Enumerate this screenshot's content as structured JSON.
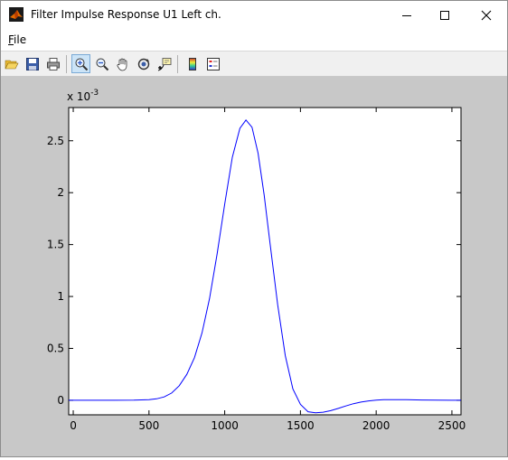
{
  "window": {
    "title": "Filter Impulse Response  U1 Left ch.",
    "controls": [
      "minimize",
      "maximize",
      "close"
    ]
  },
  "menu": {
    "file_label": "File"
  },
  "toolbar": {
    "buttons": [
      {
        "name": "open-file-button",
        "icon": "folder-open-icon"
      },
      {
        "name": "save-button",
        "icon": "floppy-disk-icon"
      },
      {
        "name": "print-button",
        "icon": "printer-icon"
      },
      {
        "name": "zoom-in-button",
        "icon": "zoom-in-icon",
        "active": true
      },
      {
        "name": "zoom-out-button",
        "icon": "zoom-out-icon"
      },
      {
        "name": "pan-button",
        "icon": "hand-icon"
      },
      {
        "name": "rotate-3d-button",
        "icon": "rotate-icon"
      },
      {
        "name": "data-cursor-button",
        "icon": "data-cursor-icon"
      },
      {
        "name": "insert-colorbar-button",
        "icon": "colorbar-icon"
      },
      {
        "name": "insert-legend-button",
        "icon": "legend-icon"
      }
    ]
  },
  "chart_data": {
    "type": "line",
    "title": "",
    "xlabel": "",
    "ylabel": "",
    "exponent_label": "x 10",
    "exponent_power": "-3",
    "xlim": [
      -30,
      2560
    ],
    "ylim": [
      -0.00014,
      0.00282
    ],
    "xticks": [
      0,
      500,
      1000,
      1500,
      2000,
      2500
    ],
    "yticks": [
      0,
      0.0005,
      0.001,
      0.0015,
      0.002,
      0.0025
    ],
    "ytick_labels": [
      "0",
      "0.5",
      "1",
      "1.5",
      "2",
      "2.5"
    ],
    "grid": false,
    "series": [
      {
        "color": "#0000ff",
        "x": [
          -30,
          0,
          200,
          400,
          500,
          550,
          600,
          650,
          700,
          750,
          800,
          850,
          900,
          950,
          1000,
          1050,
          1100,
          1140,
          1180,
          1220,
          1260,
          1300,
          1350,
          1400,
          1450,
          1500,
          1550,
          1600,
          1650,
          1700,
          1750,
          1800,
          1850,
          1900,
          1950,
          2000,
          2050,
          2100,
          2200,
          2300,
          2400,
          2500,
          2560
        ],
        "y": [
          0,
          0,
          0,
          2e-06,
          6e-06,
          1.4e-05,
          3.2e-05,
          7e-05,
          0.00014,
          0.00025,
          0.00041,
          0.00065,
          0.00098,
          0.00141,
          0.00189,
          0.00234,
          0.00262,
          0.0027,
          0.00263,
          0.00238,
          0.00198,
          0.0015,
          0.00092,
          0.00043,
          0.00011,
          -4e-05,
          -0.00011,
          -0.00012,
          -0.000115,
          -0.0001,
          -7.8e-05,
          -5.5e-05,
          -3.3e-05,
          -1.7e-05,
          -6e-06,
          1e-06,
          5e-06,
          6e-06,
          5e-06,
          3e-06,
          1e-06,
          0,
          0
        ]
      }
    ]
  }
}
